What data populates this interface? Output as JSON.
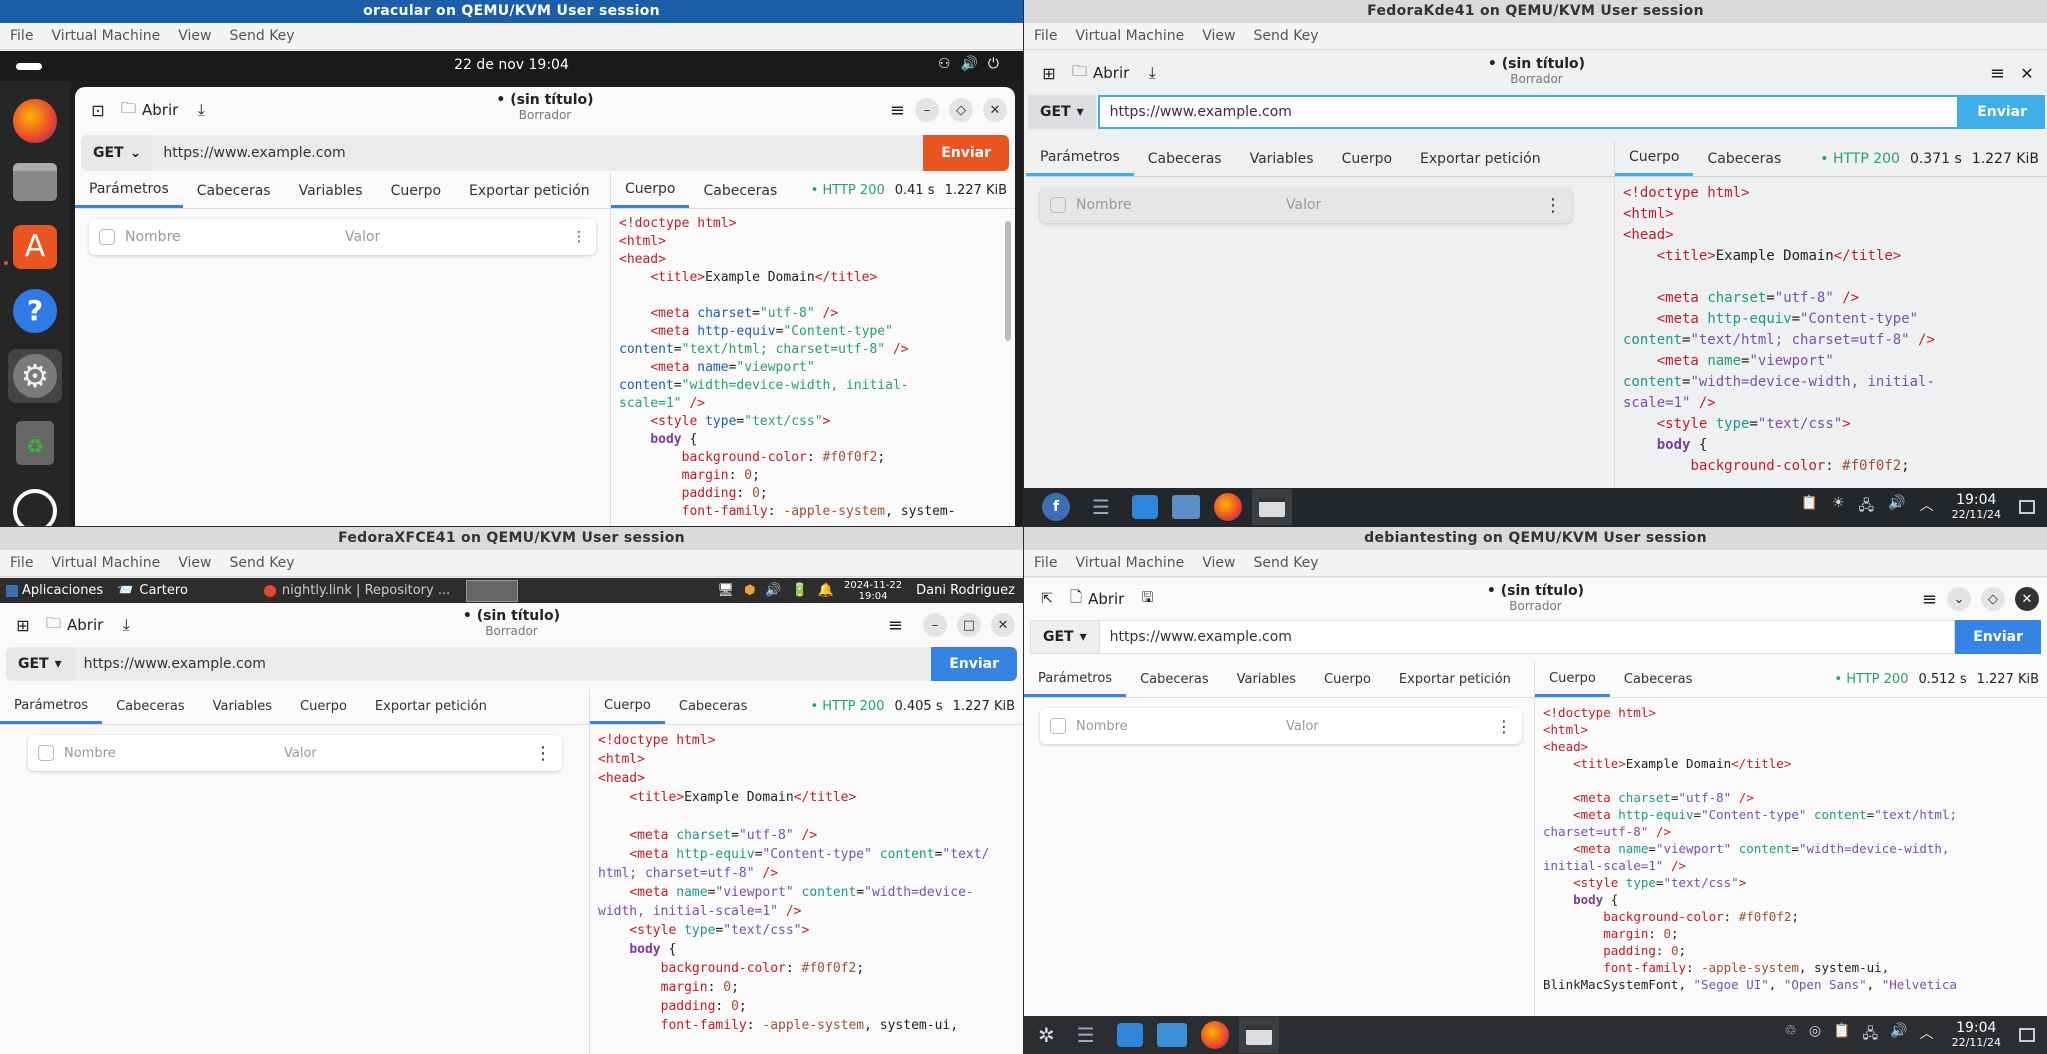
{
  "menu": {
    "file": "File",
    "vm": "Virtual Machine",
    "view": "View",
    "sendkey": "Send Key"
  },
  "vms": {
    "tl": {
      "title": "oracular on QEMU/KVM User session",
      "clock": "22 de nov  19:04"
    },
    "tr": {
      "title": "FedoraKde41 on QEMU/KVM User session",
      "time": "19:04",
      "date": "22/11/24"
    },
    "bl": {
      "title": "FedoraXFCE41 on QEMU/KVM User session",
      "apps": "Aplicaciones",
      "task1": "Cartero",
      "task2": "nightly.link | Repository ...",
      "clock_date": "2024-11-22",
      "clock_time": "19:04",
      "user": "Dani Rodriguez"
    },
    "br": {
      "title": "debiantesting on QEMU/KVM User session",
      "time": "19:04",
      "date": "22/11/24"
    }
  },
  "app": {
    "title": "• (sin título)",
    "subtitle": "Borrador",
    "open": "Abrir",
    "method": "GET",
    "url": "https://www.example.com",
    "send": "Enviar",
    "tabs": [
      "Parámetros",
      "Cabeceras",
      "Variables",
      "Cuerpo",
      "Exportar petición"
    ],
    "resp_tabs": [
      "Cuerpo",
      "Cabeceras"
    ],
    "name_ph": "Nombre",
    "value_ph": "Valor"
  },
  "stats": {
    "tl": {
      "code": "• HTTP 200",
      "time": "0.41 s",
      "size": "1.227 KiB"
    },
    "tr": {
      "code": "• HTTP 200",
      "time": "0.371 s",
      "size": "1.227 KiB"
    },
    "bl": {
      "code": "• HTTP 200",
      "time": "0.405 s",
      "size": "1.227 KiB"
    },
    "br": {
      "code": "• HTTP 200",
      "time": "0.512 s",
      "size": "1.227 KiB"
    }
  },
  "colors": {
    "gnome_send": "#e95420",
    "blue_send": "#3584e4",
    "kde_send": "#3daee9"
  }
}
